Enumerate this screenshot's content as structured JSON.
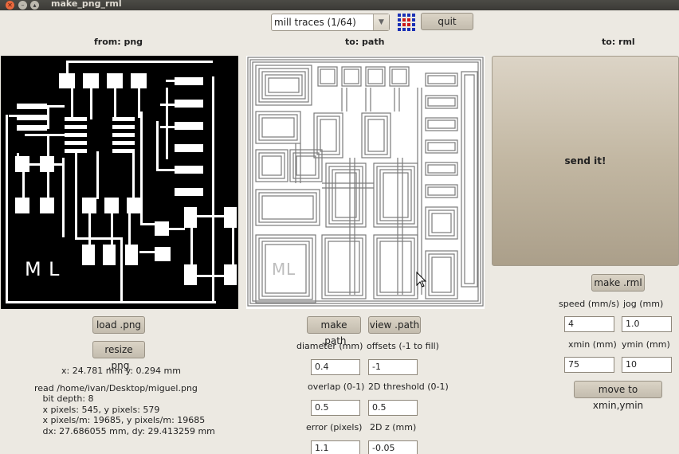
{
  "window": {
    "title": "make_png_rml"
  },
  "toolbar": {
    "mode_select": "mill traces (1/64)",
    "mode_arrow": "▼",
    "quit_label": "quit"
  },
  "png_panel": {
    "heading": "from: png",
    "board_text_m": "M",
    "board_text_l": "L",
    "load_label": "load .png",
    "resize_label": "resize .png",
    "coords": "x: 24.781 mm  y: 0.294 mm",
    "info_lines": [
      "read /home/ivan/Desktop/miguel.png",
      "   bit depth: 8",
      "   x pixels: 545, y pixels: 579",
      "   x pixels/m: 19685, y pixels/m: 19685",
      "   dx: 27.686055 mm, dy: 29.413259 mm"
    ]
  },
  "path_panel": {
    "heading": "to: path",
    "make_label": "make .path",
    "view_label": "view .path",
    "diameter_label": "diameter (mm)",
    "diameter_value": "0.4",
    "offsets_label": "offsets (-1 to fill)",
    "offsets_value": "-1",
    "overlap_label": "overlap (0-1)",
    "overlap_value": "0.5",
    "threshold_label": "2D threshold (0-1)",
    "threshold_value": "0.5",
    "error_label": "error (pixels)",
    "error_value": "1.1",
    "z_label": "2D z (mm)",
    "z_value": "-0.05"
  },
  "rml_panel": {
    "heading": "to: rml",
    "send_label": "send it!",
    "make_label": "make .rml",
    "speed_label": "speed (mm/s)",
    "speed_value": "4",
    "jog_label": "jog (mm)",
    "jog_value": "1.0",
    "xmin_label": "xmin (mm)",
    "xmin_value": "75",
    "ymin_label": "ymin (mm)",
    "ymin_value": "10",
    "move_label": "move to xmin,ymin"
  },
  "colors": {
    "background": "#ece9e2",
    "titlebar": "#3f3e3a",
    "close_button": "#e9683d",
    "logo_blue": "#1a2fb4",
    "logo_red": "#cc1a1a"
  }
}
